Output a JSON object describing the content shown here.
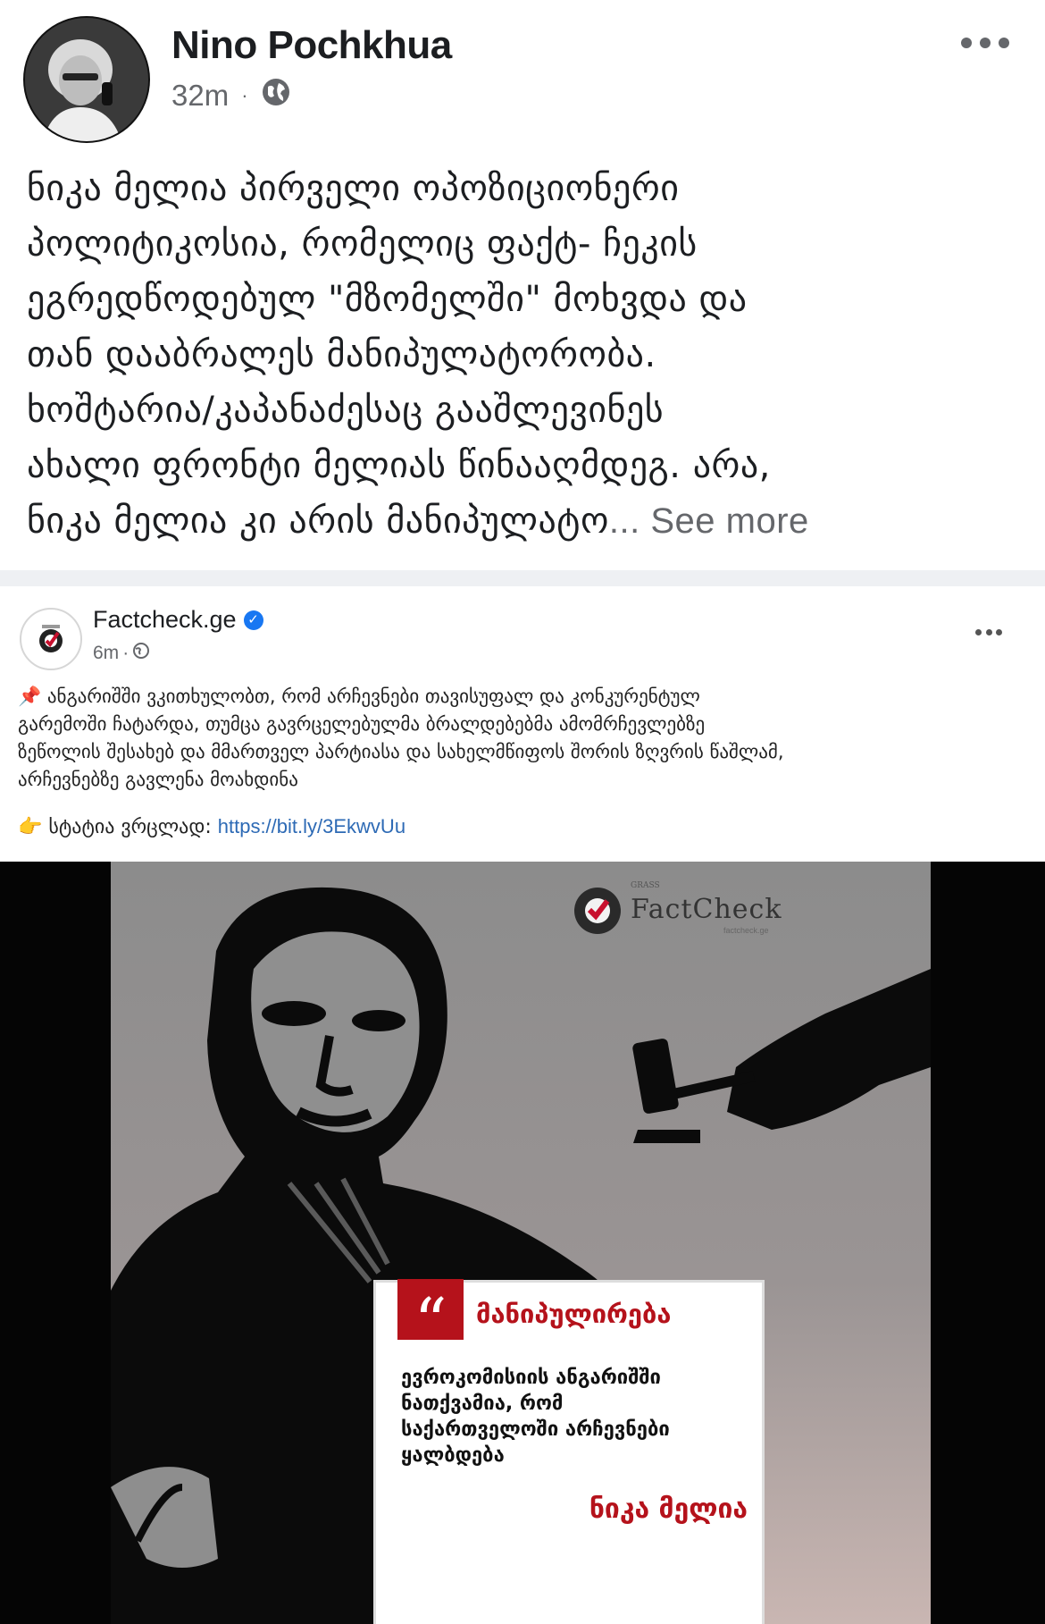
{
  "post": {
    "author": "Nino Pochkhua",
    "time": "32m",
    "dot": "·",
    "privacy_icon": "globe-icon",
    "text_lines": [
      "ნიკა მელია პირველი ოპოზიციონერი",
      "პოლიტიკოსია, რომელიც ფაქტ- ჩეკის",
      "ეგრედწოდებულ \"მზომელში\" მოხვდა და",
      "თან დააბრალეს მანიპულატორობა.",
      "ხოშტარია/კაპანაძესაც გააშლევინეს",
      "ახალი ფრონტი მელიას წინააღმდეგ. არა,",
      "ნიკა მელია კი არის მანიპულატო"
    ],
    "ellipsis": "...",
    "see_more": " See more"
  },
  "shared_post": {
    "page_name": "Factcheck.ge",
    "time": "6m",
    "dot": "·",
    "text_lines": [
      "📌 ანგარიშში ვკითხულობთ, რომ არჩევნები თავისუფალ და კონკურენტულ",
      "გარემოში ჩატარდა, თუმცა გავრცელებულმა ბრალდებებმა ამომრჩევლებზე",
      "ზეწოლის შესახებ და მმართველ პარტიასა და სახელმწიფოს შორის ზღვრის წაშლამ,",
      "არჩევნებზე გავლენა მოახდინა"
    ],
    "link_prefix": "👉 სტატია ვრცლად: ",
    "link": "https://bit.ly/3EkwvUu"
  },
  "poster": {
    "brand_small": "GRASS",
    "brand": "FactCheck",
    "brand_sub": "factcheck.ge",
    "quote_mark": "“",
    "verdict": "მანიპულირება",
    "quote_lines": [
      "ევროკომისიის ანგარიშში",
      "ნათქვამია, რომ",
      "საქართველოში არჩევნები",
      "ყალბდება"
    ],
    "speaker": "ნიკა მელია"
  },
  "colors": {
    "accent_red": "#b5121b",
    "link_blue": "#2d6ab5",
    "meta_gray": "#65676b",
    "verified_blue": "#1877f2"
  }
}
